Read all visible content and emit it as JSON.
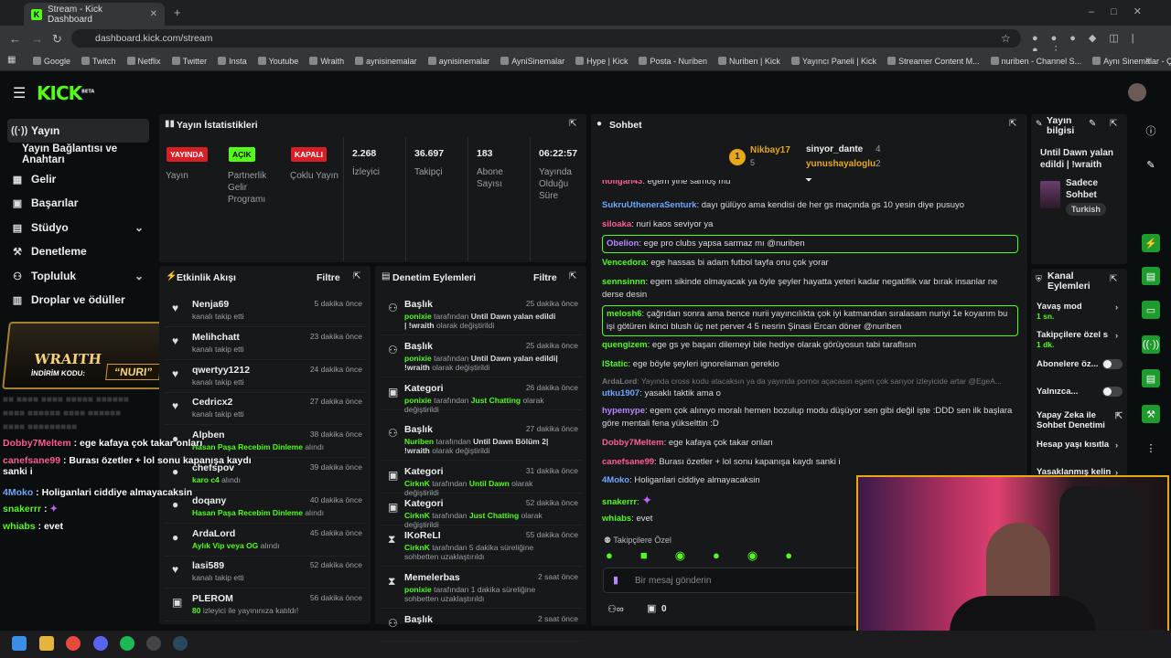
{
  "browser": {
    "tab_title": "Stream - Kick Dashboard",
    "url": "dashboard.kick.com/stream",
    "bookmarks": [
      "Google",
      "Twitch",
      "Netflix",
      "Twitter",
      "Insta",
      "Youtube",
      "Wraith",
      "aynisinemalar",
      "aynisinemalar",
      "AyniSinemalar",
      "Hype | Kick",
      "Posta - Nuriben",
      "Nuriben | Kick",
      "Yayıncı Paneli | Kick",
      "Streamer Content M...",
      "nuriben - Channel S...",
      "Aynı Sinemalar - Ça..."
    ]
  },
  "header": {
    "logo": "KICK",
    "beta": "BETA"
  },
  "sidebar": [
    "Yayın",
    "Yayın Bağlantısı ve Anahtarı",
    "Gelir",
    "Başarılar",
    "Stüdyo",
    "Denetleme",
    "Topluluk",
    "Droplar ve ödüller"
  ],
  "stats": {
    "title": "Yayın İstatistikleri",
    "badges": [
      {
        "badge": "YAYINDA",
        "label": "Yayın"
      },
      {
        "badge": "AÇIK",
        "label": "Partnerlik Gelir Programı"
      },
      {
        "badge": "KAPALI",
        "label": "Çoklu Yayın"
      }
    ],
    "values": [
      {
        "value": "2.268",
        "label": "İzleyici"
      },
      {
        "value": "36.697",
        "label": "Takipçi"
      },
      {
        "value": "183",
        "label": "Abone Sayısı"
      },
      {
        "value": "06:22:57",
        "label": "Yayında Olduğu Süre"
      }
    ]
  },
  "activity": {
    "title": "Etkinlik Akışı",
    "filter": "Filtre",
    "items": [
      {
        "name": "Nenja69",
        "sub": "kanalı takip etti",
        "time": "5 dakika önce"
      },
      {
        "name": "Melihchatt",
        "sub": "kanalı takip etti",
        "time": "23 dakika önce"
      },
      {
        "name": "qwertyy1212",
        "sub": "kanalı takip etti",
        "time": "24 dakika önce"
      },
      {
        "name": "Cedricx2",
        "sub": "kanalı takip etti",
        "time": "27 dakika önce"
      },
      {
        "name": "Alpben",
        "sub_g": "Hasan Paşa Recebim Dinleme",
        "sub": " alındı",
        "time": "38 dakika önce"
      },
      {
        "name": "chefspov",
        "sub_g": "karo c4",
        "sub": " alındı",
        "time": "39 dakika önce"
      },
      {
        "name": "doqany",
        "sub_g": "Hasan Paşa Recebim Dinleme",
        "sub": " alındı",
        "time": "40 dakika önce"
      },
      {
        "name": "ArdaLord",
        "sub_g": "Aylık Vip veya OG",
        "sub": " alındı",
        "time": "45 dakika önce"
      },
      {
        "name": "lasi589",
        "sub": "kanalı takip etti",
        "time": "52 dakika önce"
      },
      {
        "name": "PLEROM",
        "sub_g": "80",
        "sub": " izleyici ile yayınınıza katıldı!",
        "time": "56 dakika önce"
      }
    ]
  },
  "moderation": {
    "title": "Denetim Eylemleri",
    "filter": "Filtre",
    "items": [
      {
        "name": "Başlık",
        "time": "25 dakika önce",
        "who": "ponixie",
        "mid": " tarafından ",
        "val": "Until Dawn yalan edildi | !wraith",
        "end": " olarak değiştirildi"
      },
      {
        "name": "Başlık",
        "time": "25 dakika önce",
        "who": "ponixie",
        "mid": " tarafından ",
        "val": "Until Dawn yalan edildi| !wraith",
        "end": " olarak değiştirildi"
      },
      {
        "name": "Kategori",
        "time": "26 dakika önce",
        "who": "ponixie",
        "mid": " tarafından ",
        "val": "Just Chatting",
        "end": " olarak değiştirildi"
      },
      {
        "name": "Başlık",
        "time": "27 dakika önce",
        "who": "Nuriben",
        "mid": " tarafından ",
        "val": "Until Dawn Bölüm 2| !wraith",
        "end": " olarak değiştirildi"
      },
      {
        "name": "Kategori",
        "time": "31 dakika önce",
        "who": "CirknK",
        "mid": " tarafından ",
        "val": "Until Dawn",
        "end": " olarak değiştirildi"
      },
      {
        "name": "Kategori",
        "time": "52 dakika önce",
        "who": "CirknK",
        "mid": " tarafından ",
        "val": "Just Chatting",
        "end": " olarak değiştirildi"
      },
      {
        "name": "IKoReLI",
        "time": "55 dakika önce",
        "who": "CirknK",
        "mid": " tarafından 5 dakika süreliğine sohbetten uzaklaştırıldı",
        "val": "",
        "end": ""
      },
      {
        "name": "Memelerbas",
        "time": "2 saat önce",
        "who": "ponixie",
        "mid": " tarafından 1 dakika süreliğine sohbetten uzaklaştırıldı",
        "val": "",
        "end": ""
      },
      {
        "name": "Başlık",
        "time": "2 saat önce",
        "who": "",
        "mid": "",
        "val": "",
        "end": ""
      }
    ]
  },
  "chat": {
    "title": "Sohbet",
    "top": {
      "rank": "1",
      "user1": "Nikbay17",
      "c1": "5",
      "user2": "sinyor_dante",
      "c2": "4",
      "user3": "yunushayaloglu",
      "c3": "2"
    },
    "messages": [
      {
        "user": "holigan43",
        "text": "egem yine sarhoş mu",
        "color": "#ff5c9a"
      },
      {
        "user": "SukruUtheneraSenturk",
        "text": "dayı gülüyo ama kendisi de her gs maçında gs 10 yesin diye pusuyo",
        "color": "#6ea8ff"
      },
      {
        "user": "siloaka",
        "text": "nuri kaos seviyor ya",
        "color": "#ff5c9a"
      },
      {
        "user": "Obelion",
        "text": "ege pro clubs yapsa sarmaz mı @nuriben",
        "color": "#b388ff",
        "hl": true
      },
      {
        "user": "Vencedora",
        "text": "ege hassas bi adam futbol tayfa onu çok yorar",
        "color": "#53fc18"
      },
      {
        "user": "sennsinnn",
        "text": "egem sikinde olmayacak ya öyle şeyler hayatta yeteri kadar negatiflik var bırak insanlar ne derse desin",
        "color": "#53fc18"
      },
      {
        "user": "melosh6",
        "text": "çağrıdan sonra ama bence nurii yayıncılıkta çok iyi katmandan sıralasam nuriyi 1e koyarım bu işi götüren ikinci blush üç net perver 4 5 nesrin Şinasi Ercan döner @nuriben",
        "color": "#53fc18",
        "hl": true
      },
      {
        "user": "quengizem",
        "text": "ege gs ye başarı dilemeyi bile hediye olarak görüyosun tabi taraflısın",
        "color": "#53fc18"
      },
      {
        "user": "lStatic",
        "text": "ege böyle şeyleri ignorelaman gerekio",
        "color": "#53fc18"
      },
      {
        "user": "ArdaLord",
        "text": "Yayında cross kodu atacaksın ya da yayında pornoı açacasın egem çok sarıyor izleyicide artar @EgeA...",
        "color": "#777",
        "dim": true
      },
      {
        "user": "utku1907",
        "text": "yasaklı taktik ama o",
        "color": "#6ea8ff"
      },
      {
        "user": "hypemype",
        "text": "egem çok alınıyo moralı hemen bozulup modu düşüyor sen gibi değil işte :DDD sen ilk başlara göre mentali fena yükselttin :D",
        "color": "#b388ff"
      },
      {
        "user": "Dobby7Meltem",
        "text": "ege kafaya çok takar onları",
        "color": "#ff5c9a"
      },
      {
        "user": "canefsane99",
        "text": "Burası özetler + lol sonu kapanışa kaydı sanki i",
        "color": "#ff5c9a"
      },
      {
        "user": "4Moko",
        "text": "Holiganlari ciddiye almayacaksin",
        "color": "#6ea8ff"
      },
      {
        "user": "snakerrr",
        "text": "",
        "color": "#53fc18"
      },
      {
        "user": "whiabs",
        "text": "evet",
        "color": "#53fc18"
      }
    ],
    "followers_only": "Takipçilere Özel",
    "placeholder": "Bir mesaj gönderin",
    "count": "0"
  },
  "overlay": {
    "brand": "WRAITH",
    "code_label": "İNDİRİM KODU:",
    "code": "NURI",
    "messages": [
      {
        "user": "Dobby7Meltem",
        "text": "ege kafaya çok takar onları",
        "color": "#ff5c9a"
      },
      {
        "user": "canefsane99",
        "text": "Burası özetler + lol sonu kapanışa kaydı sanki i",
        "color": "#ff5c9a"
      },
      {
        "user": "4Moko",
        "text": "Holiganlari ciddiye almayacaksin",
        "color": "#6ea8ff"
      },
      {
        "user": "snakerrr",
        "text": "",
        "color": "#53fc18"
      },
      {
        "user": "whiabs",
        "text": "evet",
        "color": "#53fc18"
      }
    ]
  },
  "stream_info": {
    "title": "Yayın bilgisi",
    "stream_title": "Until Dawn yalan edildi | !wraith",
    "category": "Sadece Sohbet",
    "language": "Turkish"
  },
  "channel_actions": {
    "title": "Kanal Eylemleri",
    "items": [
      {
        "label": "Yavaş mod",
        "sub": "1 sn."
      },
      {
        "label": "Takipçilere özel s",
        "sub": "1 dk."
      },
      {
        "label": "Abonelere öz..."
      },
      {
        "label": "Yalnızca..."
      },
      {
        "label": "Yapay Zeka ile Sohbet Denetimi"
      },
      {
        "label": "Hesap yaşı kısıtla"
      },
      {
        "label": "Yasaklanmış kelin"
      }
    ]
  },
  "colors": {
    "accent": "#53fc18",
    "panel": "#16181a",
    "bg": "#0b0e0f",
    "live_red": "#d81f26"
  }
}
